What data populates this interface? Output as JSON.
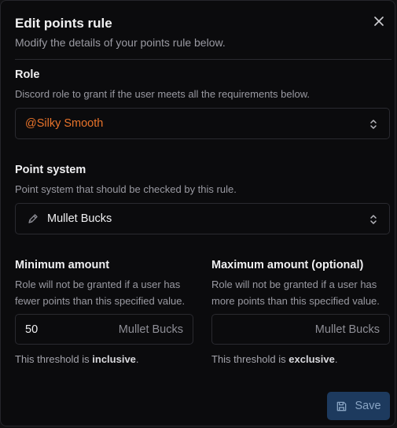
{
  "dialog": {
    "title": "Edit points rule",
    "subtitle": "Modify the details of your points rule below."
  },
  "role": {
    "label": "Role",
    "description": "Discord role to grant if the user meets all the requirements below.",
    "value": "@Silky Smooth",
    "value_color": "#e8732a"
  },
  "point_system": {
    "label": "Point system",
    "description": "Point system that should be checked by this rule.",
    "value": "Mullet Bucks",
    "icon": "pencil-icon"
  },
  "minimum": {
    "label": "Minimum amount",
    "description_line1": "Role will not be granted if a user has",
    "description_line2": "fewer points than this specified value.",
    "value": "50",
    "unit": "Mullet Bucks",
    "threshold_prefix": "This threshold is ",
    "threshold_word": "inclusive",
    "threshold_suffix": "."
  },
  "maximum": {
    "label": "Maximum amount (optional)",
    "description_line1": "Role will not be granted if a user has",
    "description_line2": "more points than this specified value.",
    "value": "",
    "unit": "Mullet Bucks",
    "threshold_prefix": "This threshold is ",
    "threshold_word": "exclusive",
    "threshold_suffix": "."
  },
  "actions": {
    "save_label": "Save"
  },
  "icons": {
    "close": "close-icon",
    "chevrons": "chevron-up-down-icon",
    "save": "save-icon"
  }
}
